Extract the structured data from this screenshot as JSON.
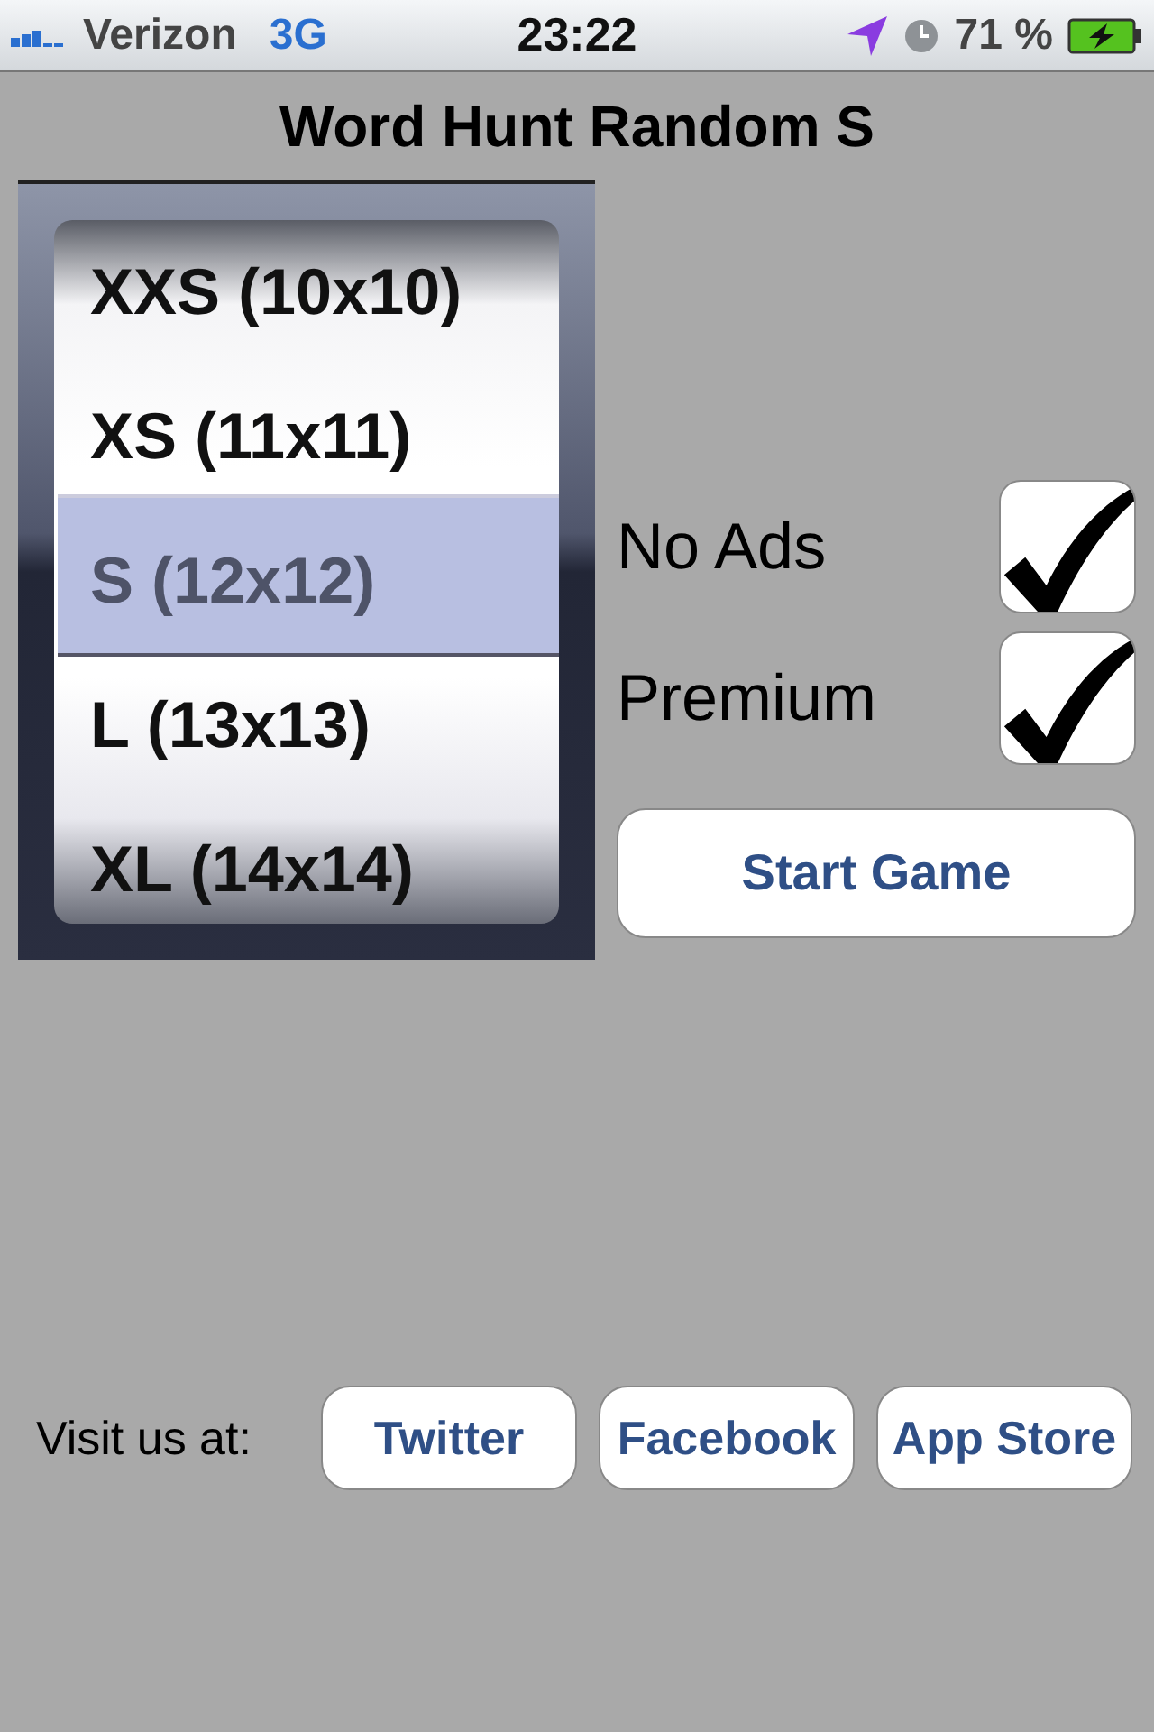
{
  "status_bar": {
    "carrier": "Verizon",
    "network": "3G",
    "time": "23:22",
    "battery": "71 %"
  },
  "title": "Word Hunt Random S",
  "picker": {
    "items": [
      {
        "label": "XXS (10x10)",
        "selected": false
      },
      {
        "label": "XS (11x11)",
        "selected": false
      },
      {
        "label": "S (12x12)",
        "selected": true
      },
      {
        "label": "L (13x13)",
        "selected": false
      },
      {
        "label": "XL (14x14)",
        "selected": false
      }
    ]
  },
  "options": [
    {
      "label": "No Ads",
      "checked": true
    },
    {
      "label": "Premium",
      "checked": true
    }
  ],
  "start_button": "Start Game",
  "footer": {
    "label": "Visit us at:",
    "links": [
      "Twitter",
      "Facebook",
      "App Store"
    ]
  }
}
